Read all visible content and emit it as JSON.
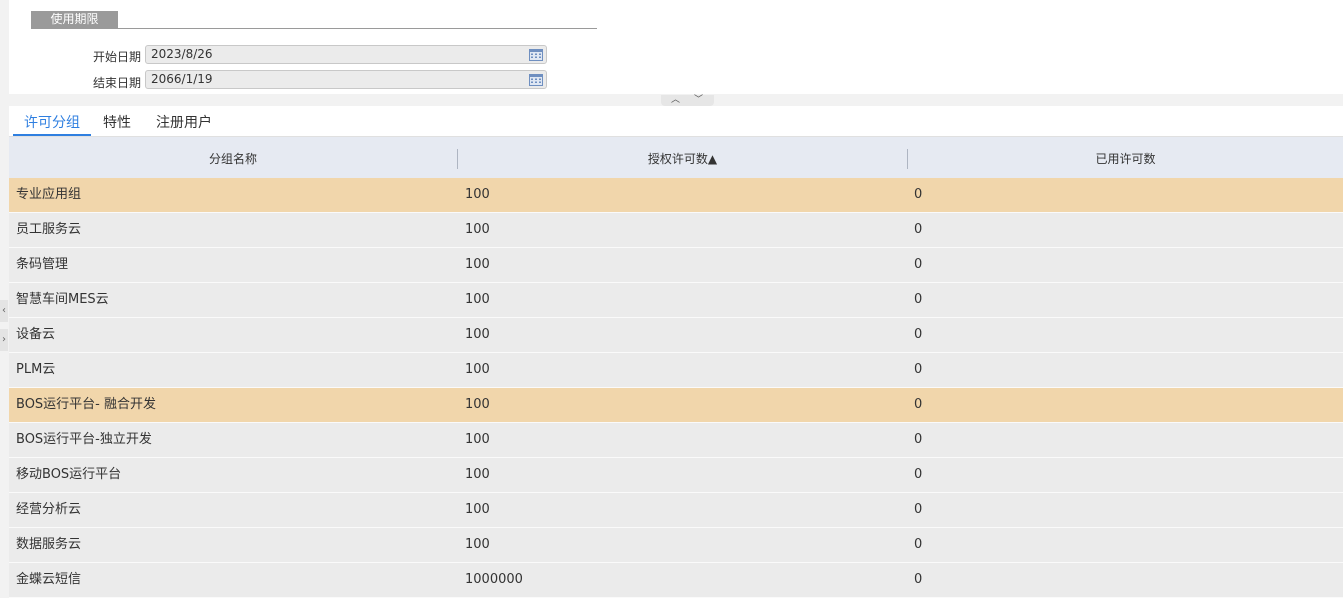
{
  "period": {
    "title": "使用期限",
    "start_label": "开始日期",
    "start_value": "2023/8/26",
    "end_label": "结束日期",
    "end_value": "2066/1/19"
  },
  "tabs": [
    {
      "label": "许可分组",
      "active": true
    },
    {
      "label": "特性",
      "active": false
    },
    {
      "label": "注册用户",
      "active": false
    }
  ],
  "grid": {
    "columns": [
      "分组名称",
      "授权许可数▲",
      "已用许可数"
    ],
    "rows": [
      {
        "name": "专业应用组",
        "licensed": "100",
        "used": "0",
        "highlight": true
      },
      {
        "name": "员工服务云",
        "licensed": "100",
        "used": "0",
        "highlight": false
      },
      {
        "name": "条码管理",
        "licensed": "100",
        "used": "0",
        "highlight": false
      },
      {
        "name": "智慧车间MES云",
        "licensed": "100",
        "used": "0",
        "highlight": false
      },
      {
        "name": "设备云",
        "licensed": "100",
        "used": "0",
        "highlight": false
      },
      {
        "name": "PLM云",
        "licensed": "100",
        "used": "0",
        "highlight": false
      },
      {
        "name": "BOS运行平台- 融合开发",
        "licensed": "100",
        "used": "0",
        "highlight": true
      },
      {
        "name": "BOS运行平台-独立开发",
        "licensed": "100",
        "used": "0",
        "highlight": false
      },
      {
        "name": "移动BOS运行平台",
        "licensed": "100",
        "used": "0",
        "highlight": false
      },
      {
        "name": "经营分析云",
        "licensed": "100",
        "used": "0",
        "highlight": false
      },
      {
        "name": "数据服务云",
        "licensed": "100",
        "used": "0",
        "highlight": false
      },
      {
        "name": "金蝶云短信",
        "licensed": "1000000",
        "used": "0",
        "highlight": false
      }
    ]
  },
  "colors": {
    "highlight_row": "#f1d6ab",
    "row": "#ebebeb",
    "header": "#e6eaf2",
    "active_tab": "#2f7fe0",
    "calendar_icon": "#6f8fc0"
  },
  "icons": {
    "calendar": "calendar-icon",
    "collapse_up": "chevron-up-icon",
    "expand_down": "chevron-down-icon",
    "side_left": "chevron-left-icon",
    "side_right": "chevron-right-icon"
  }
}
